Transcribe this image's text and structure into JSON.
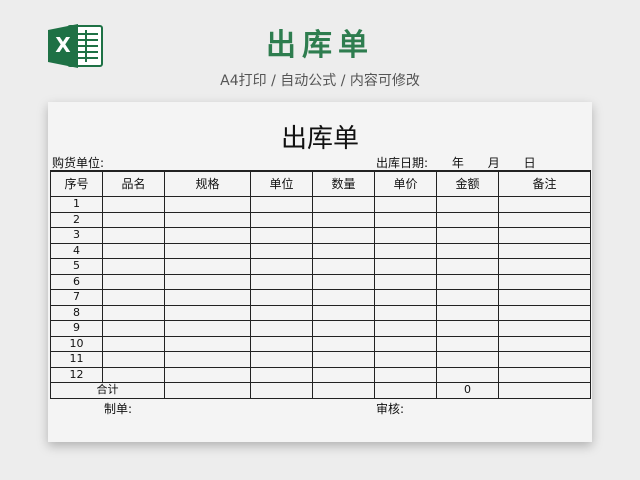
{
  "header": {
    "title": "出库单",
    "subtitle": "A4打印 / 自动公式 / 内容可修改"
  },
  "form": {
    "title": "出库单",
    "buyer_label": "购货单位:",
    "date_label": "出库日期:",
    "year_label": "年",
    "month_label": "月",
    "day_label": "日",
    "columns": [
      "序号",
      "品名",
      "规格",
      "单位",
      "数量",
      "单价",
      "金额",
      "备注"
    ],
    "rows": [
      "1",
      "2",
      "3",
      "4",
      "5",
      "6",
      "7",
      "8",
      "9",
      "10",
      "11",
      "12"
    ],
    "total_label": "合计",
    "total_amount": "0",
    "maker_label": "制单:",
    "auditor_label": "审核:"
  },
  "colors": {
    "accent": "#2e7d4f",
    "excel_green": "#1e7145",
    "background": "#ededed"
  },
  "icons": {
    "logo": "excel-icon"
  }
}
